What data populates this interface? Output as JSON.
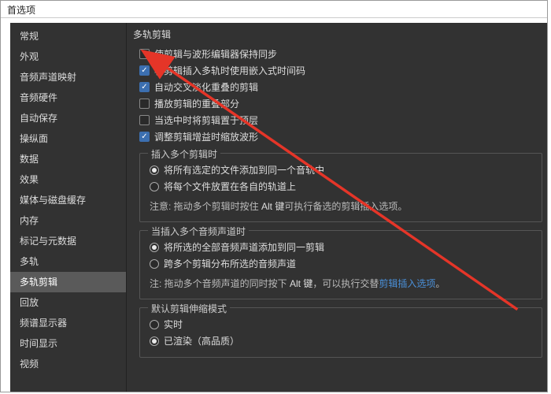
{
  "window": {
    "title": "首选项"
  },
  "sidebar": {
    "items": [
      {
        "label": "常规"
      },
      {
        "label": "外观"
      },
      {
        "label": "音频声道映射"
      },
      {
        "label": "音频硬件"
      },
      {
        "label": "自动保存"
      },
      {
        "label": "操纵面"
      },
      {
        "label": "数据"
      },
      {
        "label": "效果"
      },
      {
        "label": "媒体与磁盘缓存"
      },
      {
        "label": "内存"
      },
      {
        "label": "标记与元数据"
      },
      {
        "label": "多轨"
      },
      {
        "label": "多轨剪辑"
      },
      {
        "label": "回放"
      },
      {
        "label": "频谱显示器"
      },
      {
        "label": "时间显示"
      },
      {
        "label": "视频"
      }
    ],
    "selectedIndex": 12
  },
  "main": {
    "heading": "多轨剪辑",
    "checkboxes": [
      {
        "label": "使剪辑与波形编辑器保持同步",
        "checked": false
      },
      {
        "label": "将剪辑插入多轨时使用嵌入式时间码",
        "checked": true
      },
      {
        "label": "自动交叉淡化重叠的剪辑",
        "checked": true
      },
      {
        "label": "播放剪辑的重叠部分",
        "checked": false
      },
      {
        "label": "当选中时将剪辑置于顶层",
        "checked": false
      },
      {
        "label": "调整剪辑增益时缩放波形",
        "checked": true
      }
    ],
    "group1": {
      "legend": "插入多个剪辑时",
      "radios": [
        {
          "label": "将所有选定的文件添加到同一个音轨中",
          "selected": true
        },
        {
          "label": "将每个文件放置在各自的轨道上",
          "selected": false
        }
      ],
      "note_prefix": "注意: 拖动多个剪辑时按住 ",
      "note_kbd": "Alt 键",
      "note_suffix": "可执行备选的剪辑插入选项。"
    },
    "group2": {
      "legend": "当插入多个音频声道时",
      "radios": [
        {
          "label": "将所选的全部音频声道添加到同一剪辑",
          "selected": true
        },
        {
          "label": "跨多个剪辑分布所选的音频声道",
          "selected": false
        }
      ],
      "note_prefix": "注: 拖动多个音频声道的同时按下 ",
      "note_kbd": "Alt 键",
      "note_mid": "，可以执行交替",
      "note_link": "剪辑插入选项",
      "note_suffix": "。"
    },
    "group3": {
      "legend": "默认剪辑伸缩模式",
      "radios": [
        {
          "label": "实时",
          "selected": false
        },
        {
          "label": "已渲染（高品质）",
          "selected": true
        }
      ]
    }
  }
}
